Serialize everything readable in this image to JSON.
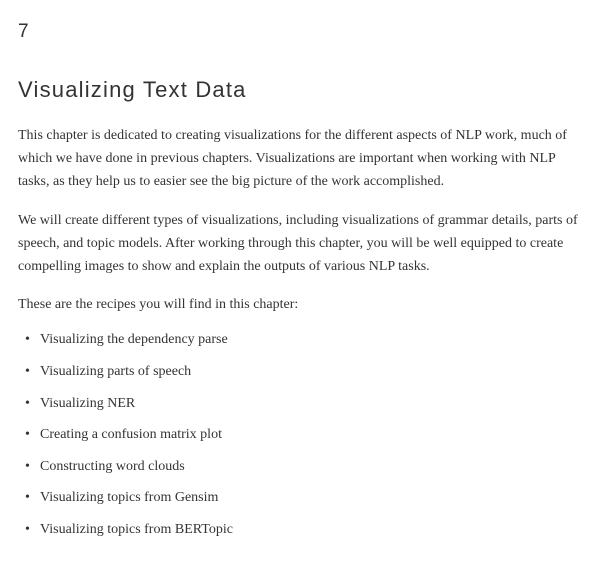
{
  "chapter": {
    "number": "7",
    "title": "Visualizing Text Data",
    "paragraphs": [
      "This chapter is dedicated to creating visualizations for the different aspects of NLP work, much of which we have done in previous chapters. Visualizations are important when working with NLP tasks, as they help us to easier see the big picture of the work accomplished.",
      "We will create different types of visualizations, including visualizations of grammar details, parts of speech, and topic models. After working through this chapter, you will be well equipped to create compelling images to show and explain the outputs of various NLP tasks."
    ],
    "list_intro": "These are the recipes you will find in this chapter:",
    "recipes": [
      "Visualizing the dependency parse",
      "Visualizing parts of speech",
      "Visualizing NER",
      "Creating a confusion matrix plot",
      "Constructing word clouds",
      "Visualizing topics from Gensim",
      "Visualizing topics from BERTopic"
    ]
  }
}
